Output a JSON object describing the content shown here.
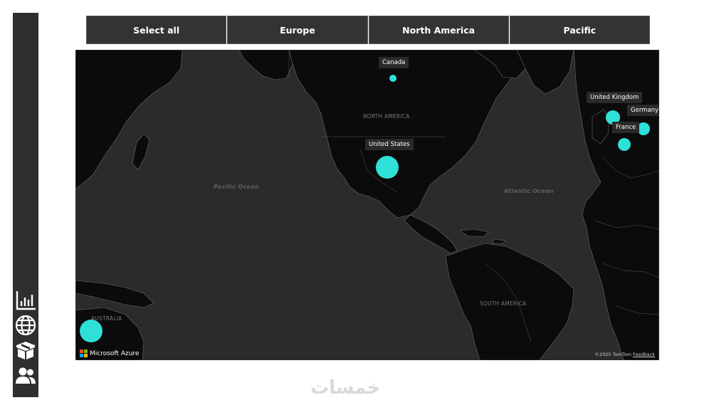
{
  "sidebar": {
    "items": [
      {
        "icon": "bar-chart-icon",
        "label": ""
      },
      {
        "icon": "globe-icon",
        "label": ""
      },
      {
        "icon": "box-icon",
        "label": ""
      },
      {
        "icon": "users-icon",
        "label": ""
      }
    ]
  },
  "filters": {
    "buttons": [
      "Select all",
      "Europe",
      "North America",
      "Pacific"
    ]
  },
  "map": {
    "ocean_labels": {
      "pacific": "Pacific Ocean",
      "atlantic": "Atlantic Ocean"
    },
    "region_labels": {
      "north_america": "NORTH AMERICA",
      "south_america": "SOUTH AMERICA",
      "australia": "AUSTRALIA"
    },
    "countries": [
      {
        "name": "Canada",
        "size": "small"
      },
      {
        "name": "United States",
        "size": "large"
      },
      {
        "name": "United Kingdom",
        "size": "medium"
      },
      {
        "name": "Germany",
        "size": "medium"
      },
      {
        "name": "France",
        "size": "medium"
      }
    ],
    "bubble_color": "#2ee0d8",
    "brand": "Microsoft Azure",
    "attribution": "©2025 TomTom",
    "feedback": "Feedback"
  },
  "watermark": "خمسات",
  "colors": {
    "sidebar_bg": "#2f2f2f",
    "button_bg": "#333333",
    "land": "#0b0b0b",
    "ocean": "#2b2b2b",
    "bubble": "#2ee0d8"
  }
}
